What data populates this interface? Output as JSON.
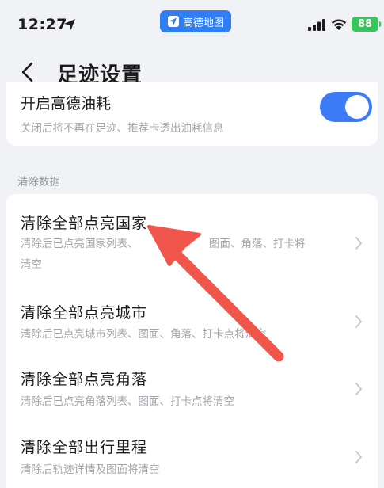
{
  "status_bar": {
    "time": "12:27",
    "app_name": "高德地图",
    "battery": "88"
  },
  "nav": {
    "title": "足迹设置"
  },
  "settings": {
    "fuel": {
      "title": "开启高德油耗",
      "subtitle": "关闭后将不再在足迹、推荐卡透出油耗信息",
      "enabled": true
    }
  },
  "section": {
    "label": "清除数据"
  },
  "clear_items": [
    {
      "title": "清除全部点亮国家",
      "subtitle_line1": "清除后已点亮国家列表、",
      "subtitle_line1b": "图面、角落、打卡将",
      "subtitle_line2": "清空"
    },
    {
      "title": "清除全部点亮城市",
      "subtitle_line1": "清除后已点亮城市列表、图面、角落、打卡点将清空"
    },
    {
      "title": "清除全部点亮角落",
      "subtitle_line1": "清除后已点亮角落列表、图面、打卡点将清空"
    },
    {
      "title": "清除全部出行里程",
      "subtitle_line1": "清除后轨迹详情及图面将清空"
    }
  ],
  "colors": {
    "accent": "#3b7cf6",
    "background": "#f1f2f6",
    "annotation_arrow": "#f0564b"
  }
}
